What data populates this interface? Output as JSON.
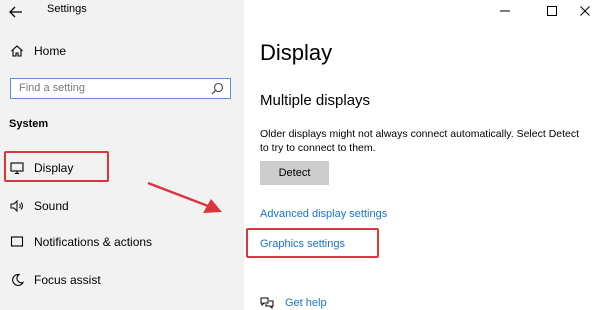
{
  "window": {
    "title": "Settings",
    "controls": [
      "minimize",
      "maximize",
      "close"
    ]
  },
  "sidebar": {
    "home_label": "Home",
    "search": {
      "placeholder": "Find a setting"
    },
    "section_title": "System",
    "items": [
      {
        "label": "Display",
        "icon": "monitor-icon",
        "selected": true
      },
      {
        "label": "Sound",
        "icon": "speaker-icon"
      },
      {
        "label": "Notifications & actions",
        "icon": "notification-icon"
      },
      {
        "label": "Focus assist",
        "icon": "moon-icon"
      }
    ]
  },
  "main": {
    "title": "Display",
    "section_title": "Multiple displays",
    "description": "Older displays might not always connect automatically. Select Detect to try to connect to them.",
    "detect_button": "Detect",
    "links": {
      "advanced": "Advanced display settings",
      "graphics": "Graphics settings",
      "help": "Get help"
    }
  },
  "annotations": {
    "highlight_color": "#d9363e",
    "link_color": "#1a73c8"
  }
}
